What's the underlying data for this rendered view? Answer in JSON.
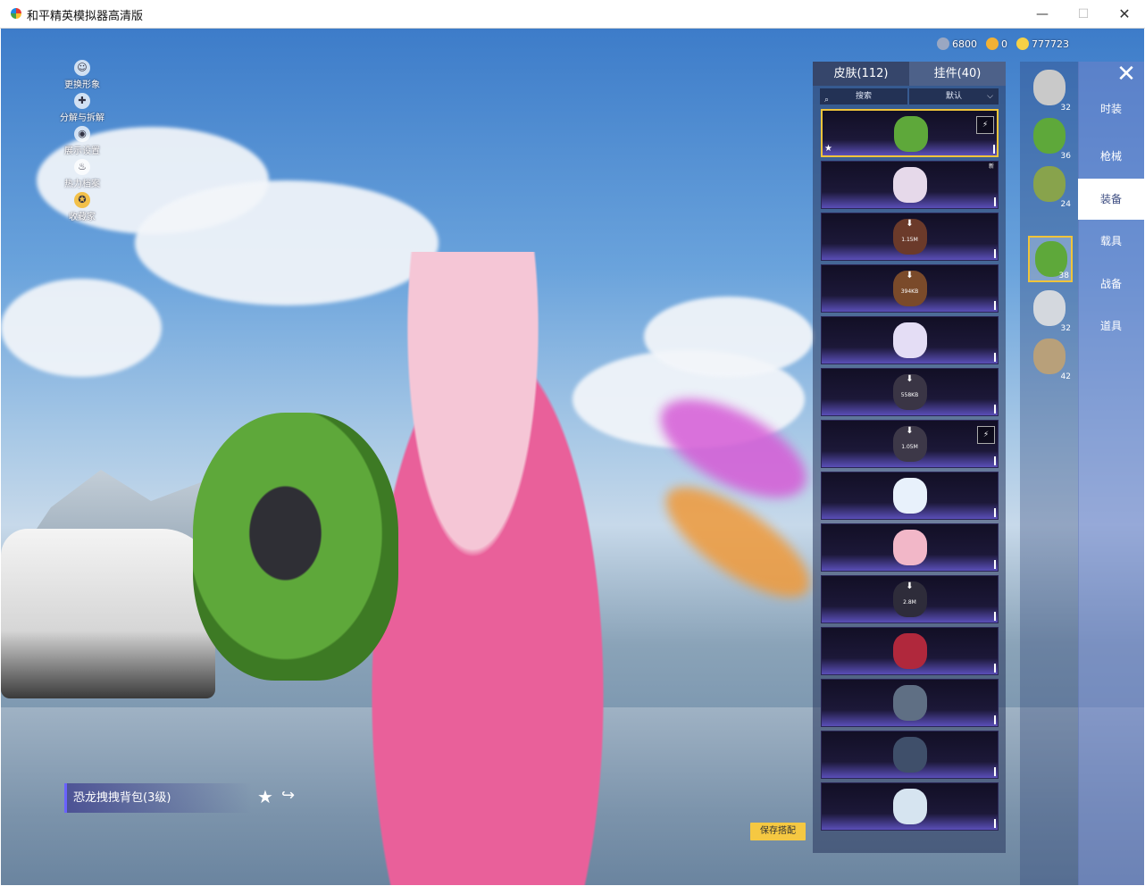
{
  "window": {
    "title": "和平精英模拟器高清版",
    "controls": {
      "minimize": "—",
      "maximize": "☐",
      "close": "✕"
    }
  },
  "left_menu": [
    {
      "label": "更换形象",
      "icon": "person-icon",
      "glyph": "☺"
    },
    {
      "label": "分解与拆解",
      "icon": "dismantle-icon",
      "glyph": "✚"
    },
    {
      "label": "展示设置",
      "icon": "eye-icon",
      "glyph": "◉"
    },
    {
      "label": "热力档案",
      "icon": "flame-icon",
      "glyph": "♨"
    },
    {
      "label": "收藏家",
      "icon": "collector-icon",
      "glyph": "✪"
    }
  ],
  "currencies": [
    {
      "value": "6800",
      "color": "#9aa7c2"
    },
    {
      "value": "0",
      "color": "#f2b134"
    },
    {
      "value": "777723",
      "color": "#f5d046"
    }
  ],
  "panel": {
    "tabs": [
      {
        "label": "皮肤(112)"
      },
      {
        "label": "挂件(40)"
      }
    ],
    "search_placeholder": "搜索",
    "sort_label": "默认",
    "slots": [
      {
        "color": "#5ea83a",
        "size": "",
        "badge": "⚡",
        "selected": true,
        "star": "★",
        "new": ""
      },
      {
        "color": "#e6d9ea",
        "size": "",
        "badge": "",
        "selected": false,
        "star": "",
        "new": "新"
      },
      {
        "color": "#6b3a2a",
        "size": "1.15M",
        "badge": "",
        "selected": false,
        "star": "",
        "new": ""
      },
      {
        "color": "#7a4a2a",
        "size": "394KB",
        "badge": "",
        "selected": false,
        "star": "",
        "new": ""
      },
      {
        "color": "#e4ddf5",
        "size": "",
        "badge": "",
        "selected": false,
        "star": "",
        "new": ""
      },
      {
        "color": "#3a3545",
        "size": "558KB",
        "badge": "",
        "selected": false,
        "star": "",
        "new": ""
      },
      {
        "color": "#3d3848",
        "size": "1.05M",
        "badge": "⚡",
        "selected": false,
        "star": "",
        "new": ""
      },
      {
        "color": "#e8f1fb",
        "size": "",
        "badge": "",
        "selected": false,
        "star": "",
        "new": ""
      },
      {
        "color": "#f2b7c8",
        "size": "",
        "badge": "",
        "selected": false,
        "star": "",
        "new": ""
      },
      {
        "color": "#2e2c3a",
        "size": "2.8M",
        "badge": "",
        "selected": false,
        "star": "",
        "new": ""
      },
      {
        "color": "#b0283c",
        "size": "",
        "badge": "",
        "selected": false,
        "star": "",
        "new": ""
      },
      {
        "color": "#5f6f84",
        "size": "",
        "badge": "",
        "selected": false,
        "star": "",
        "new": ""
      },
      {
        "color": "#3f4f6a",
        "size": "",
        "badge": "",
        "selected": false,
        "star": "",
        "new": ""
      },
      {
        "color": "#d6e4f0",
        "size": "",
        "badge": "",
        "selected": false,
        "star": "",
        "new": ""
      }
    ]
  },
  "equipment_slots": [
    {
      "count": "32",
      "color": "#c9c9c9"
    },
    {
      "count": "36",
      "color": "#5ea83a"
    },
    {
      "count": "24",
      "color": "#88a34c"
    },
    {
      "count": "38",
      "color": "#5ea83a"
    },
    {
      "count": "32",
      "color": "#d4d8de"
    },
    {
      "count": "42",
      "color": "#b8a07a"
    }
  ],
  "categories": [
    {
      "label": "时装"
    },
    {
      "label": "枪械"
    },
    {
      "label": "装备"
    },
    {
      "label": "载具"
    },
    {
      "label": "战备"
    },
    {
      "label": "道具"
    }
  ],
  "close_glyph": "✕",
  "selected_item": {
    "name": "恐龙拽拽背包(3级)"
  },
  "actions": {
    "save_label": "保存搭配",
    "favorite_glyph": "★",
    "share_glyph": "↪"
  },
  "accent_colors": {
    "selection_border": "#f0c43a",
    "save_button": "#f5c842"
  }
}
